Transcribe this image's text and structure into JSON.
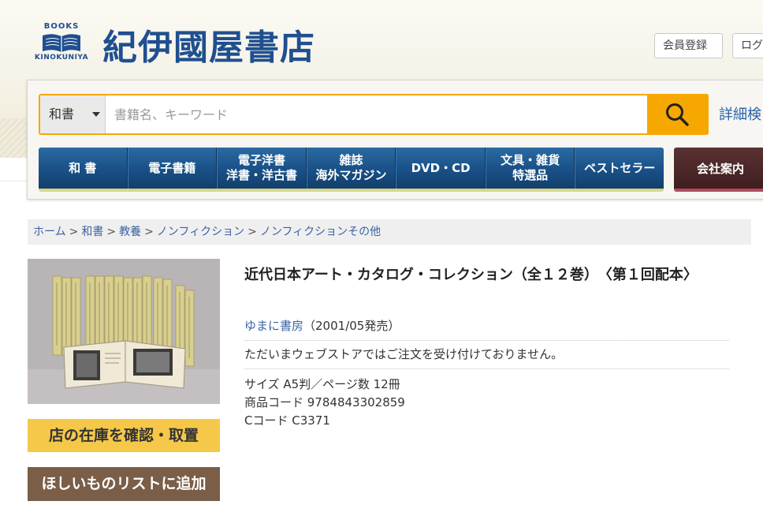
{
  "header": {
    "logo_books": "BOOKS",
    "logo_kinokuniya": "KINOKUNIYA",
    "logo_title": "紀伊國屋書店",
    "register_label": "会員登録",
    "login_label": "ログ"
  },
  "search": {
    "category_value": "和書",
    "placeholder": "書籍名、キーワード",
    "advanced_label": "詳細検"
  },
  "nav": {
    "items": [
      {
        "label": "和 書"
      },
      {
        "label": "電子書籍"
      },
      {
        "label": "電子洋書\n洋書・洋古書"
      },
      {
        "label": "雑誌\n海外マガジン"
      },
      {
        "label": "DVD・CD"
      },
      {
        "label": "文具・雑貨\n特選品"
      },
      {
        "label": "ベストセラー"
      }
    ],
    "company_label": "会社案内"
  },
  "breadcrumb": {
    "items": [
      "ホーム",
      "和書",
      "教養",
      "ノンフィクション",
      "ノンフィクションその他"
    ],
    "separator": ">"
  },
  "product": {
    "title": "近代日本アート・カタログ・コレクション（全１２巻）　〈第１回配本〉",
    "publisher": "ゆまに書房",
    "release": "（2001/05発売）",
    "notice": "ただいまウェブストアではご注文を受け付けておりません。",
    "size_line": "サイズ A5判／ページ数 12冊",
    "product_code_line": "商品コード 9784843302859",
    "c_code_line": "Cコード C3371",
    "stock_button": "店の在庫を確認・取置",
    "wishlist_button": "ほしいものリストに追加"
  },
  "colors": {
    "brand_blue": "#1f4f8f",
    "search_orange": "#f6a800",
    "stock_yellow": "#f5c84a",
    "wishlist_brown": "#7a5e48",
    "link_blue": "#3b63a3"
  }
}
